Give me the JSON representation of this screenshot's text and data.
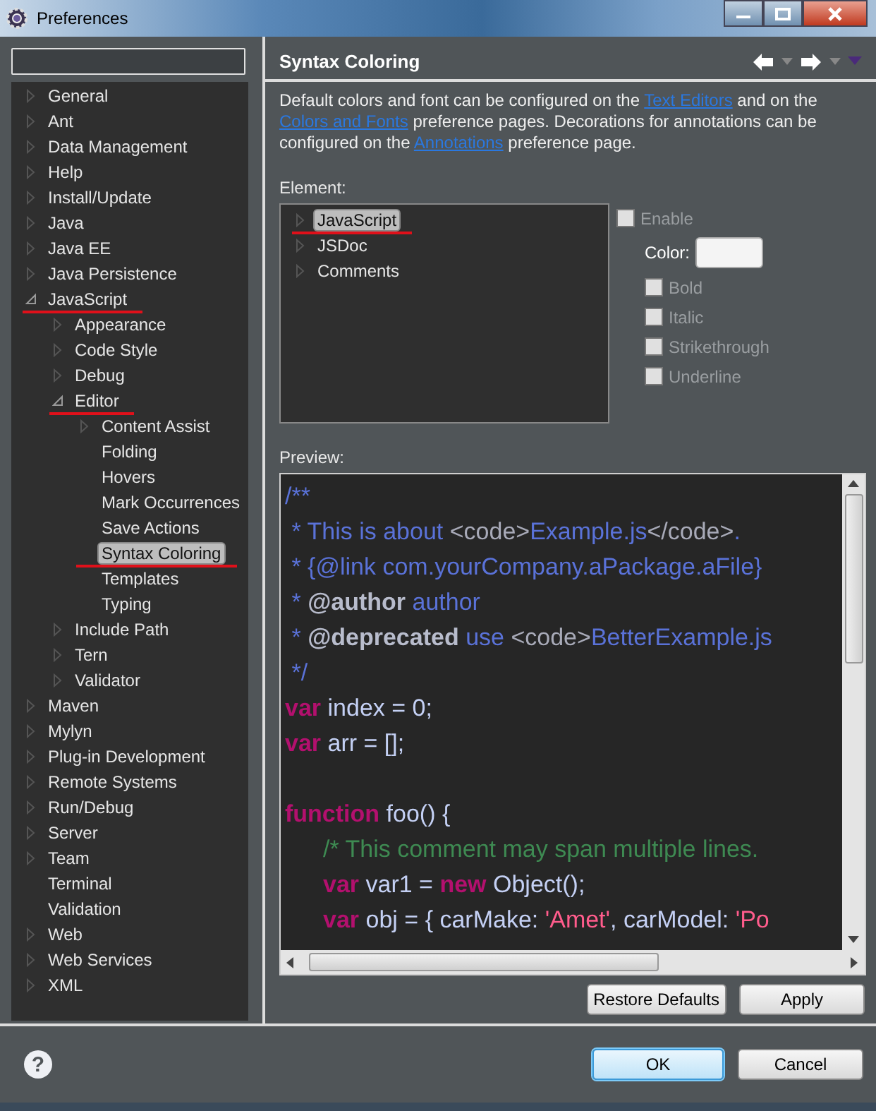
{
  "window": {
    "title": "Preferences"
  },
  "tree": [
    {
      "label": "General",
      "expandable": true,
      "expanded": false,
      "selected": false,
      "marked": false
    },
    {
      "label": "Ant",
      "expandable": true,
      "expanded": false,
      "selected": false,
      "marked": false
    },
    {
      "label": "Data Management",
      "expandable": true,
      "expanded": false,
      "selected": false,
      "marked": false
    },
    {
      "label": "Help",
      "expandable": true,
      "expanded": false,
      "selected": false,
      "marked": false
    },
    {
      "label": "Install/Update",
      "expandable": true,
      "expanded": false,
      "selected": false,
      "marked": false
    },
    {
      "label": "Java",
      "expandable": true,
      "expanded": false,
      "selected": false,
      "marked": false
    },
    {
      "label": "Java EE",
      "expandable": true,
      "expanded": false,
      "selected": false,
      "marked": false
    },
    {
      "label": "Java Persistence",
      "expandable": true,
      "expanded": false,
      "selected": false,
      "marked": false
    },
    {
      "label": "JavaScript",
      "expandable": true,
      "expanded": true,
      "selected": false,
      "marked": true,
      "children": [
        {
          "label": "Appearance",
          "expandable": true,
          "expanded": false,
          "selected": false,
          "marked": false
        },
        {
          "label": "Code Style",
          "expandable": true,
          "expanded": false,
          "selected": false,
          "marked": false
        },
        {
          "label": "Debug",
          "expandable": true,
          "expanded": false,
          "selected": false,
          "marked": false
        },
        {
          "label": "Editor",
          "expandable": true,
          "expanded": true,
          "selected": false,
          "marked": true,
          "children": [
            {
              "label": "Content Assist",
              "expandable": true,
              "expanded": false,
              "selected": false,
              "marked": false
            },
            {
              "label": "Folding",
              "expandable": false,
              "selected": false,
              "marked": false
            },
            {
              "label": "Hovers",
              "expandable": false,
              "selected": false,
              "marked": false
            },
            {
              "label": "Mark Occurrences",
              "expandable": false,
              "selected": false,
              "marked": false
            },
            {
              "label": "Save Actions",
              "expandable": false,
              "selected": false,
              "marked": false
            },
            {
              "label": "Syntax Coloring",
              "expandable": false,
              "selected": true,
              "marked": true
            },
            {
              "label": "Templates",
              "expandable": false,
              "selected": false,
              "marked": false
            },
            {
              "label": "Typing",
              "expandable": false,
              "selected": false,
              "marked": false
            }
          ]
        },
        {
          "label": "Include Path",
          "expandable": true,
          "expanded": false,
          "selected": false,
          "marked": false
        },
        {
          "label": "Tern",
          "expandable": true,
          "expanded": false,
          "selected": false,
          "marked": false
        },
        {
          "label": "Validator",
          "expandable": true,
          "expanded": false,
          "selected": false,
          "marked": false
        }
      ]
    },
    {
      "label": "Maven",
      "expandable": true,
      "expanded": false,
      "selected": false,
      "marked": false
    },
    {
      "label": "Mylyn",
      "expandable": true,
      "expanded": false,
      "selected": false,
      "marked": false
    },
    {
      "label": "Plug-in Development",
      "expandable": true,
      "expanded": false,
      "selected": false,
      "marked": false
    },
    {
      "label": "Remote Systems",
      "expandable": true,
      "expanded": false,
      "selected": false,
      "marked": false
    },
    {
      "label": "Run/Debug",
      "expandable": true,
      "expanded": false,
      "selected": false,
      "marked": false
    },
    {
      "label": "Server",
      "expandable": true,
      "expanded": false,
      "selected": false,
      "marked": false
    },
    {
      "label": "Team",
      "expandable": true,
      "expanded": false,
      "selected": false,
      "marked": false
    },
    {
      "label": "Terminal",
      "expandable": false,
      "selected": false,
      "marked": false
    },
    {
      "label": "Validation",
      "expandable": false,
      "selected": false,
      "marked": false
    },
    {
      "label": "Web",
      "expandable": true,
      "expanded": false,
      "selected": false,
      "marked": false
    },
    {
      "label": "Web Services",
      "expandable": true,
      "expanded": false,
      "selected": false,
      "marked": false
    },
    {
      "label": "XML",
      "expandable": true,
      "expanded": false,
      "selected": false,
      "marked": false
    }
  ],
  "page": {
    "title": "Syntax Coloring",
    "description": [
      {
        "kind": "text",
        "text": "Default colors and font can be configured on the "
      },
      {
        "kind": "link",
        "text": "Text Editors"
      },
      {
        "kind": "text",
        "text": " and on the "
      },
      {
        "kind": "link",
        "text": "Colors and Fonts"
      },
      {
        "kind": "text",
        "text": " preference pages.  Decorations for annotations can be configured on the "
      },
      {
        "kind": "link",
        "text": "Annotations"
      },
      {
        "kind": "text",
        "text": " preference page."
      }
    ],
    "element_label": "Element:",
    "elements": [
      {
        "label": "JavaScript",
        "selected": true,
        "marked": true
      },
      {
        "label": "JSDoc",
        "selected": false,
        "marked": false
      },
      {
        "label": "Comments",
        "selected": false,
        "marked": false
      }
    ],
    "enable": {
      "label": "Enable",
      "checked": false,
      "disabled": true
    },
    "color_label": "Color:",
    "styles": [
      {
        "label": "Bold",
        "checked": false,
        "disabled": true
      },
      {
        "label": "Italic",
        "checked": false,
        "disabled": true
      },
      {
        "label": "Strikethrough",
        "checked": false,
        "disabled": true
      },
      {
        "label": "Underline",
        "checked": false,
        "disabled": true
      }
    ],
    "preview_label": "Preview:",
    "preview_lines": [
      {
        "indent": false,
        "blank_before": false,
        "tokens": [
          {
            "kind": "doc",
            "text": "/**"
          }
        ]
      },
      {
        "indent": false,
        "blank_before": false,
        "tokens": [
          {
            "kind": "doc",
            "text": " * This is about "
          },
          {
            "kind": "html",
            "text": "<code>"
          },
          {
            "kind": "doc",
            "text": "Example.js"
          },
          {
            "kind": "html",
            "text": "</code>"
          },
          {
            "kind": "doc",
            "text": "."
          }
        ]
      },
      {
        "indent": false,
        "blank_before": false,
        "tokens": [
          {
            "kind": "doc",
            "text": " * {@link com.yourCompany.aPackage.aFile}"
          }
        ]
      },
      {
        "indent": false,
        "blank_before": false,
        "tokens": [
          {
            "kind": "doc",
            "text": " * "
          },
          {
            "kind": "tag",
            "text": "@author"
          },
          {
            "kind": "doc",
            "text": " author"
          }
        ]
      },
      {
        "indent": false,
        "blank_before": false,
        "tokens": [
          {
            "kind": "doc",
            "text": " * "
          },
          {
            "kind": "tag",
            "text": "@deprecated"
          },
          {
            "kind": "doc",
            "text": " use "
          },
          {
            "kind": "html",
            "text": "<code>"
          },
          {
            "kind": "doc",
            "text": "BetterExample.js"
          }
        ]
      },
      {
        "indent": false,
        "blank_before": false,
        "tokens": [
          {
            "kind": "doc",
            "text": " */"
          }
        ]
      },
      {
        "indent": false,
        "blank_before": false,
        "tokens": [
          {
            "kind": "keyword",
            "text": "var"
          },
          {
            "kind": "plain",
            "text": " index = 0;"
          }
        ]
      },
      {
        "indent": false,
        "blank_before": false,
        "tokens": [
          {
            "kind": "keyword",
            "text": "var"
          },
          {
            "kind": "plain",
            "text": " arr = [];"
          }
        ]
      },
      {
        "indent": false,
        "blank_before": true,
        "tokens": [
          {
            "kind": "keyword",
            "text": "function"
          },
          {
            "kind": "plain",
            "text": " foo() {"
          }
        ]
      },
      {
        "indent": true,
        "blank_before": false,
        "tokens": [
          {
            "kind": "comment",
            "text": "/* This comment may span multiple lines."
          }
        ]
      },
      {
        "indent": true,
        "blank_before": false,
        "tokens": [
          {
            "kind": "keyword",
            "text": "var"
          },
          {
            "kind": "plain",
            "text": " var1 = "
          },
          {
            "kind": "keyword",
            "text": "new"
          },
          {
            "kind": "plain",
            "text": " Object();"
          }
        ]
      },
      {
        "indent": true,
        "blank_before": false,
        "tokens": [
          {
            "kind": "keyword",
            "text": "var"
          },
          {
            "kind": "plain",
            "text": " obj = { carMake: "
          },
          {
            "kind": "string",
            "text": "'Amet'"
          },
          {
            "kind": "plain",
            "text": ", carModel: "
          },
          {
            "kind": "string",
            "text": "'Po"
          }
        ]
      }
    ]
  },
  "buttons": [
    {
      "label": "Restore Defaults",
      "kind": "page",
      "default": false
    },
    {
      "label": "Apply",
      "kind": "page",
      "default": false
    },
    {
      "label": "OK",
      "kind": "dialog",
      "default": true
    },
    {
      "label": "Cancel",
      "kind": "dialog",
      "default": false
    }
  ],
  "help": "?"
}
